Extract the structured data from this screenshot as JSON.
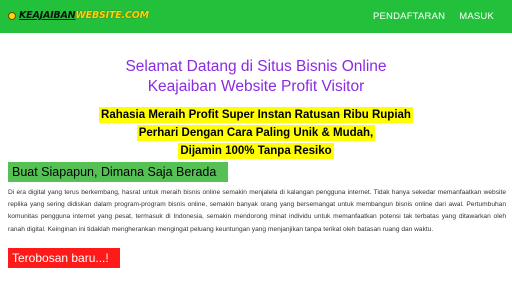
{
  "header": {
    "logo_text_a": "KEAJAIBAN",
    "logo_text_b": "WEBSITE.COM",
    "nav": [
      "PENDAFTARAN",
      "MASUK"
    ],
    "bg_color": "#23c03c"
  },
  "hero": {
    "line1": "Selamat Datang di Situs Bisnis Online",
    "line2": "Keajaiban Website Profit Visitor",
    "color": "#8a2be2"
  },
  "promo": {
    "lines": [
      "Rahasia Meraih Profit Super Instan Ratusan Ribu Rupiah",
      "Perhari Dengan Cara Paling Unik & Mudah,",
      "Dijamin 100% Tanpa Resiko"
    ],
    "highlight": "#ffff00"
  },
  "section": {
    "title": "Buat Siapapun, Dimana Saja Berada",
    "title_bg": "#55c155",
    "body": "Di era digital yang terus berkembang, hasrat untuk meraih bisnis online semakin menjalela di kalangan pengguna internet. Tidak hanya sekedar memanfaatkan website replika yang sering didiskan dalam program-program bisnis online, semakin banyak orang yang bersemangat untuk membangun bisnis online dari awal. Pertumbuhan komunitas pengguna internet yang pesat, termasuk di Indonesia, semakin mendorong minat individu untuk memanfaatkan potensi tak terbatas yang ditawarkan oleh ranah digital. Keinginan ini tidaklah mengherankan mengingat peluang keuntungan yang menjanjikan tanpa terikat oleh batasan ruang dan waktu."
  },
  "breakthrough": {
    "title": "Terobosan baru...!",
    "bg": "#ff1a1a"
  }
}
